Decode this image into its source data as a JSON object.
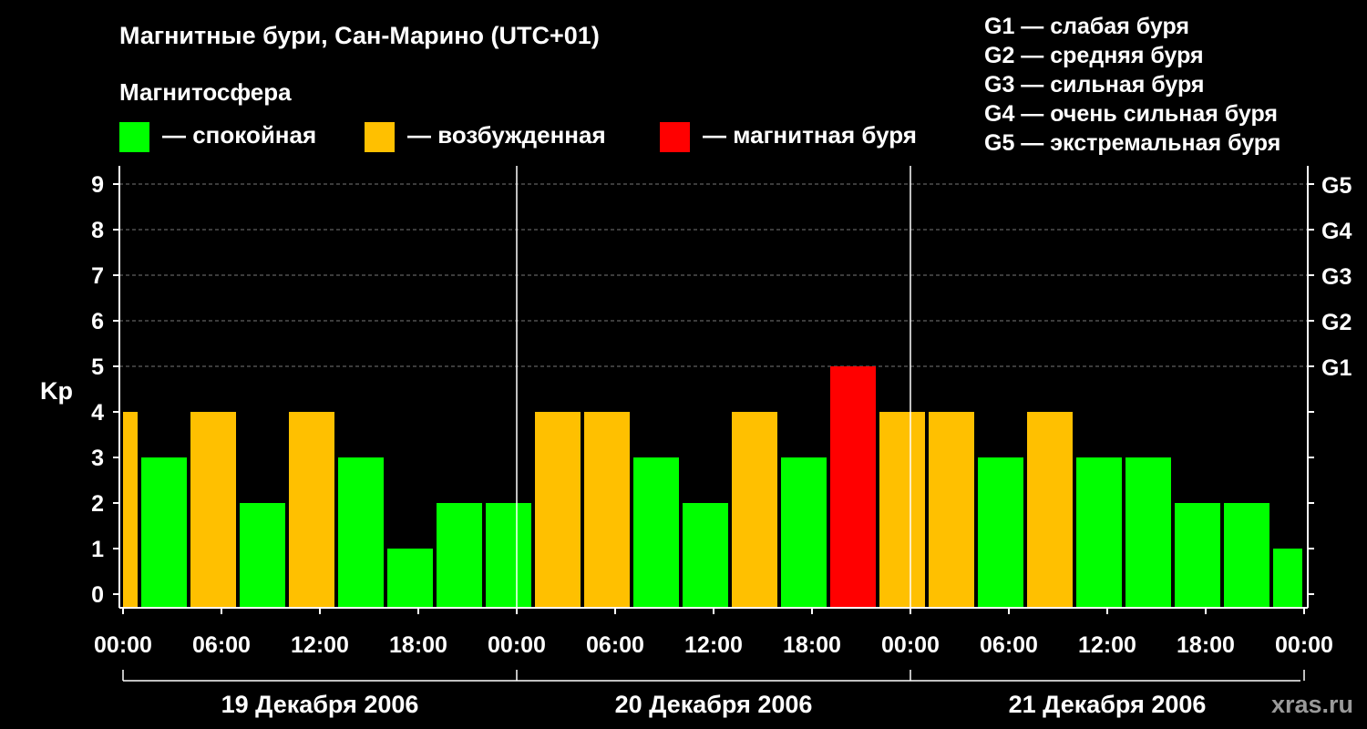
{
  "title": "Магнитные бури, Сан-Марино (UTC+01)",
  "magnetosphere": {
    "heading": "Магнитосфера",
    "legend": [
      {
        "label": "— спокойная",
        "color": "#00ff00"
      },
      {
        "label": "— возбужденная",
        "color": "#ffc000"
      },
      {
        "label": "— магнитная буря",
        "color": "#ff0000"
      }
    ]
  },
  "storm_scale": [
    "G1 — слабая буря",
    "G2 — средняя буря",
    "G3 — сильная буря",
    "G4 — очень сильная буря",
    "G5 — экстремальная буря"
  ],
  "watermark": "xras.ru",
  "chart_data": {
    "type": "bar",
    "ylabel": "Kp",
    "ylim": [
      0,
      9
    ],
    "y_ticks": [
      "0",
      "1",
      "2",
      "3",
      "4",
      "5",
      "6",
      "7",
      "8",
      "9"
    ],
    "right_axis_ticks": [
      {
        "kp": 5,
        "label": "G1"
      },
      {
        "kp": 6,
        "label": "G2"
      },
      {
        "kp": 7,
        "label": "G3"
      },
      {
        "kp": 8,
        "label": "G4"
      },
      {
        "kp": 9,
        "label": "G5"
      }
    ],
    "x_tick_labels": [
      "00:00",
      "06:00",
      "12:00",
      "18:00",
      "00:00",
      "06:00",
      "12:00",
      "18:00",
      "00:00",
      "06:00",
      "12:00",
      "18:00",
      "00:00"
    ],
    "days": [
      "19 Декабря 2006",
      "20 Декабря 2006",
      "21 Декабря 2006"
    ],
    "interval_hours": 3,
    "grid": "dashed horizontal at 5–9",
    "colors": {
      "quiet": "#00ff00",
      "active": "#ffc000",
      "storm": "#ff0000"
    },
    "series": [
      {
        "start_hour": -2,
        "kp": 4
      },
      {
        "start_hour": 1,
        "kp": 3
      },
      {
        "start_hour": 4,
        "kp": 4
      },
      {
        "start_hour": 7,
        "kp": 2
      },
      {
        "start_hour": 10,
        "kp": 4
      },
      {
        "start_hour": 13,
        "kp": 3
      },
      {
        "start_hour": 16,
        "kp": 1
      },
      {
        "start_hour": 19,
        "kp": 2
      },
      {
        "start_hour": 22,
        "kp": 2
      },
      {
        "start_hour": 25,
        "kp": 4
      },
      {
        "start_hour": 28,
        "kp": 4
      },
      {
        "start_hour": 31,
        "kp": 3
      },
      {
        "start_hour": 34,
        "kp": 2
      },
      {
        "start_hour": 37,
        "kp": 4
      },
      {
        "start_hour": 40,
        "kp": 3
      },
      {
        "start_hour": 43,
        "kp": 5
      },
      {
        "start_hour": 46,
        "kp": 4
      },
      {
        "start_hour": 49,
        "kp": 4
      },
      {
        "start_hour": 52,
        "kp": 3
      },
      {
        "start_hour": 55,
        "kp": 4
      },
      {
        "start_hour": 58,
        "kp": 3
      },
      {
        "start_hour": 61,
        "kp": 3
      },
      {
        "start_hour": 64,
        "kp": 2
      },
      {
        "start_hour": 67,
        "kp": 2
      },
      {
        "start_hour": 70,
        "kp": 1
      }
    ]
  }
}
